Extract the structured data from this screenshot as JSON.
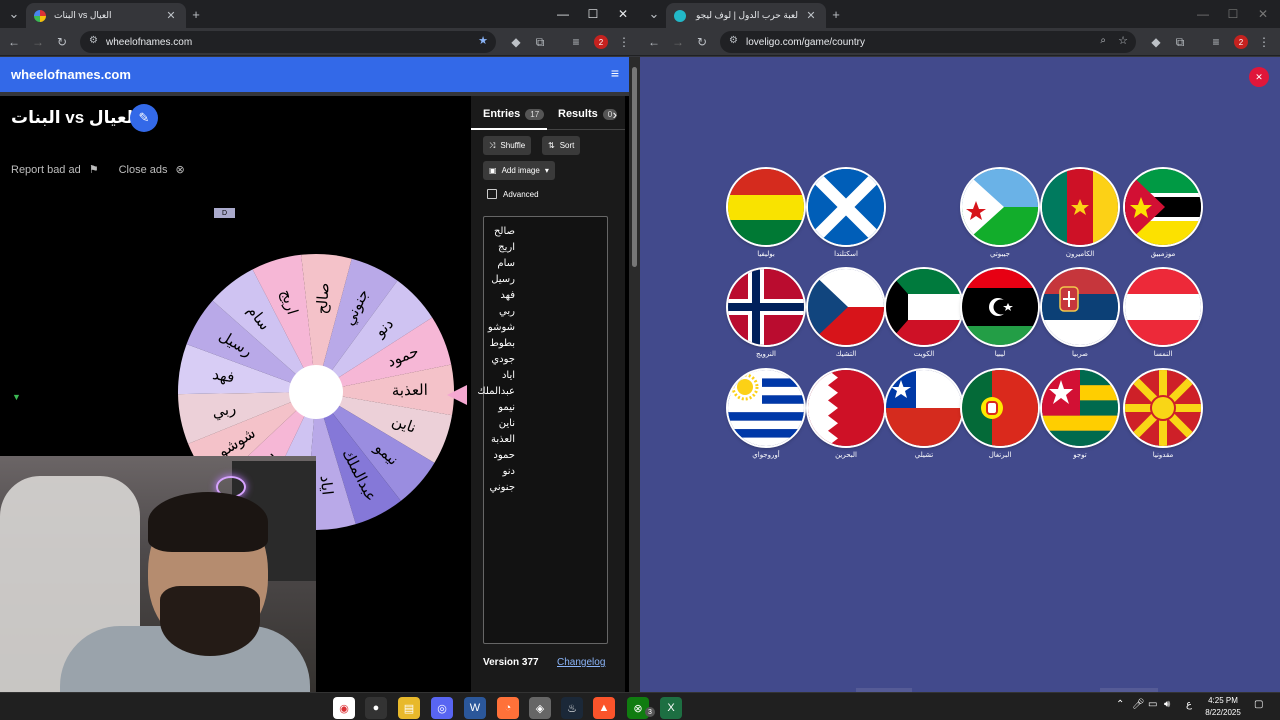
{
  "left_window": {
    "tab_title": "العيال vs البنات",
    "url": "wheelofnames.com",
    "ext_badge": "2"
  },
  "right_window": {
    "tab_title": "لعبة حرب الدول | لوف ليجو يوفر",
    "url": "loveligo.com/game/country",
    "ext_badge": "2"
  },
  "won": {
    "logo": "wheelofnames.com",
    "wheel_title": "البنات vs العيال",
    "report_bad_ad": "Report bad ad",
    "close_ads": "Close ads",
    "ad_tag": "D",
    "tabs": {
      "entries": "Entries",
      "entries_count": "17",
      "results": "Results",
      "results_count": "0"
    },
    "buttons": {
      "shuffle": "Shuffle",
      "sort": "Sort",
      "add_image": "Add image"
    },
    "advanced": "Advanced",
    "entries": [
      "صالح",
      "اريج",
      "سام",
      "رسيل",
      "فهد",
      "ربي",
      "شوشو",
      "بطوط",
      "جودي",
      "اياد",
      "عبدالملك",
      "نيمو",
      "ناين",
      "العذبة",
      "حمود",
      "دنو",
      "جنوني"
    ],
    "version": "Version 377",
    "changelog": "Changelog",
    "wheel_labels": [
      "جنوني",
      "دنو",
      "حمود",
      "العذبة",
      "ناين",
      "نيمو",
      "عبدالملك",
      "اياد",
      "جودي",
      "بطوط",
      "شوشو",
      "ربي",
      "فهد",
      "رسيل",
      "سام",
      "اريج",
      "صالح"
    ],
    "wheel_colors": [
      "#b9a9e8",
      "#cfc3f2",
      "#f6b7d6",
      "#f4c2c9",
      "#ecd0d8",
      "#9a8de0",
      "#8578d8",
      "#b9a9e8",
      "#cfc3f2",
      "#f6b7d6",
      "#f4c2c9",
      "#ecd0d8",
      "#d8cdf5",
      "#b9a9e8",
      "#cfc3f2",
      "#f6b7d6",
      "#f4c2c9"
    ]
  },
  "flags": [
    {
      "name": "بوليفيا",
      "kind": "bolivia"
    },
    {
      "name": "اسكتلندا",
      "kind": "scotland"
    },
    {
      "name": "جيبوتي",
      "kind": "djibouti"
    },
    {
      "name": "الكاميرون",
      "kind": "cameroon"
    },
    {
      "name": "موزمبيق",
      "kind": "mozambique"
    },
    {
      "name": "النرويج",
      "kind": "norway"
    },
    {
      "name": "التشيك",
      "kind": "czech"
    },
    {
      "name": "الكويت",
      "kind": "kuwait"
    },
    {
      "name": "ليبيا",
      "kind": "libya"
    },
    {
      "name": "صربيا",
      "kind": "serbia"
    },
    {
      "name": "النمسا",
      "kind": "austria"
    },
    {
      "name": "أوروجواي",
      "kind": "uruguay"
    },
    {
      "name": "البحرين",
      "kind": "bahrain"
    },
    {
      "name": "تشيلي",
      "kind": "chile"
    },
    {
      "name": "البرتغال",
      "kind": "portugal"
    },
    {
      "name": "توجو",
      "kind": "togo"
    },
    {
      "name": "مقدونيا",
      "kind": "macedonia"
    }
  ],
  "taskbar": {
    "time": "4:25 PM",
    "date": "8/22/2025",
    "lang": "ع",
    "apps": [
      "chrome-icon",
      "obs-icon",
      "file-explorer-icon",
      "discord-icon",
      "word-icon",
      "firefox-icon",
      "game-icon",
      "steam-icon",
      "brave-icon",
      "xbox-icon",
      "excel-icon"
    ],
    "xbox_badge": "3"
  }
}
